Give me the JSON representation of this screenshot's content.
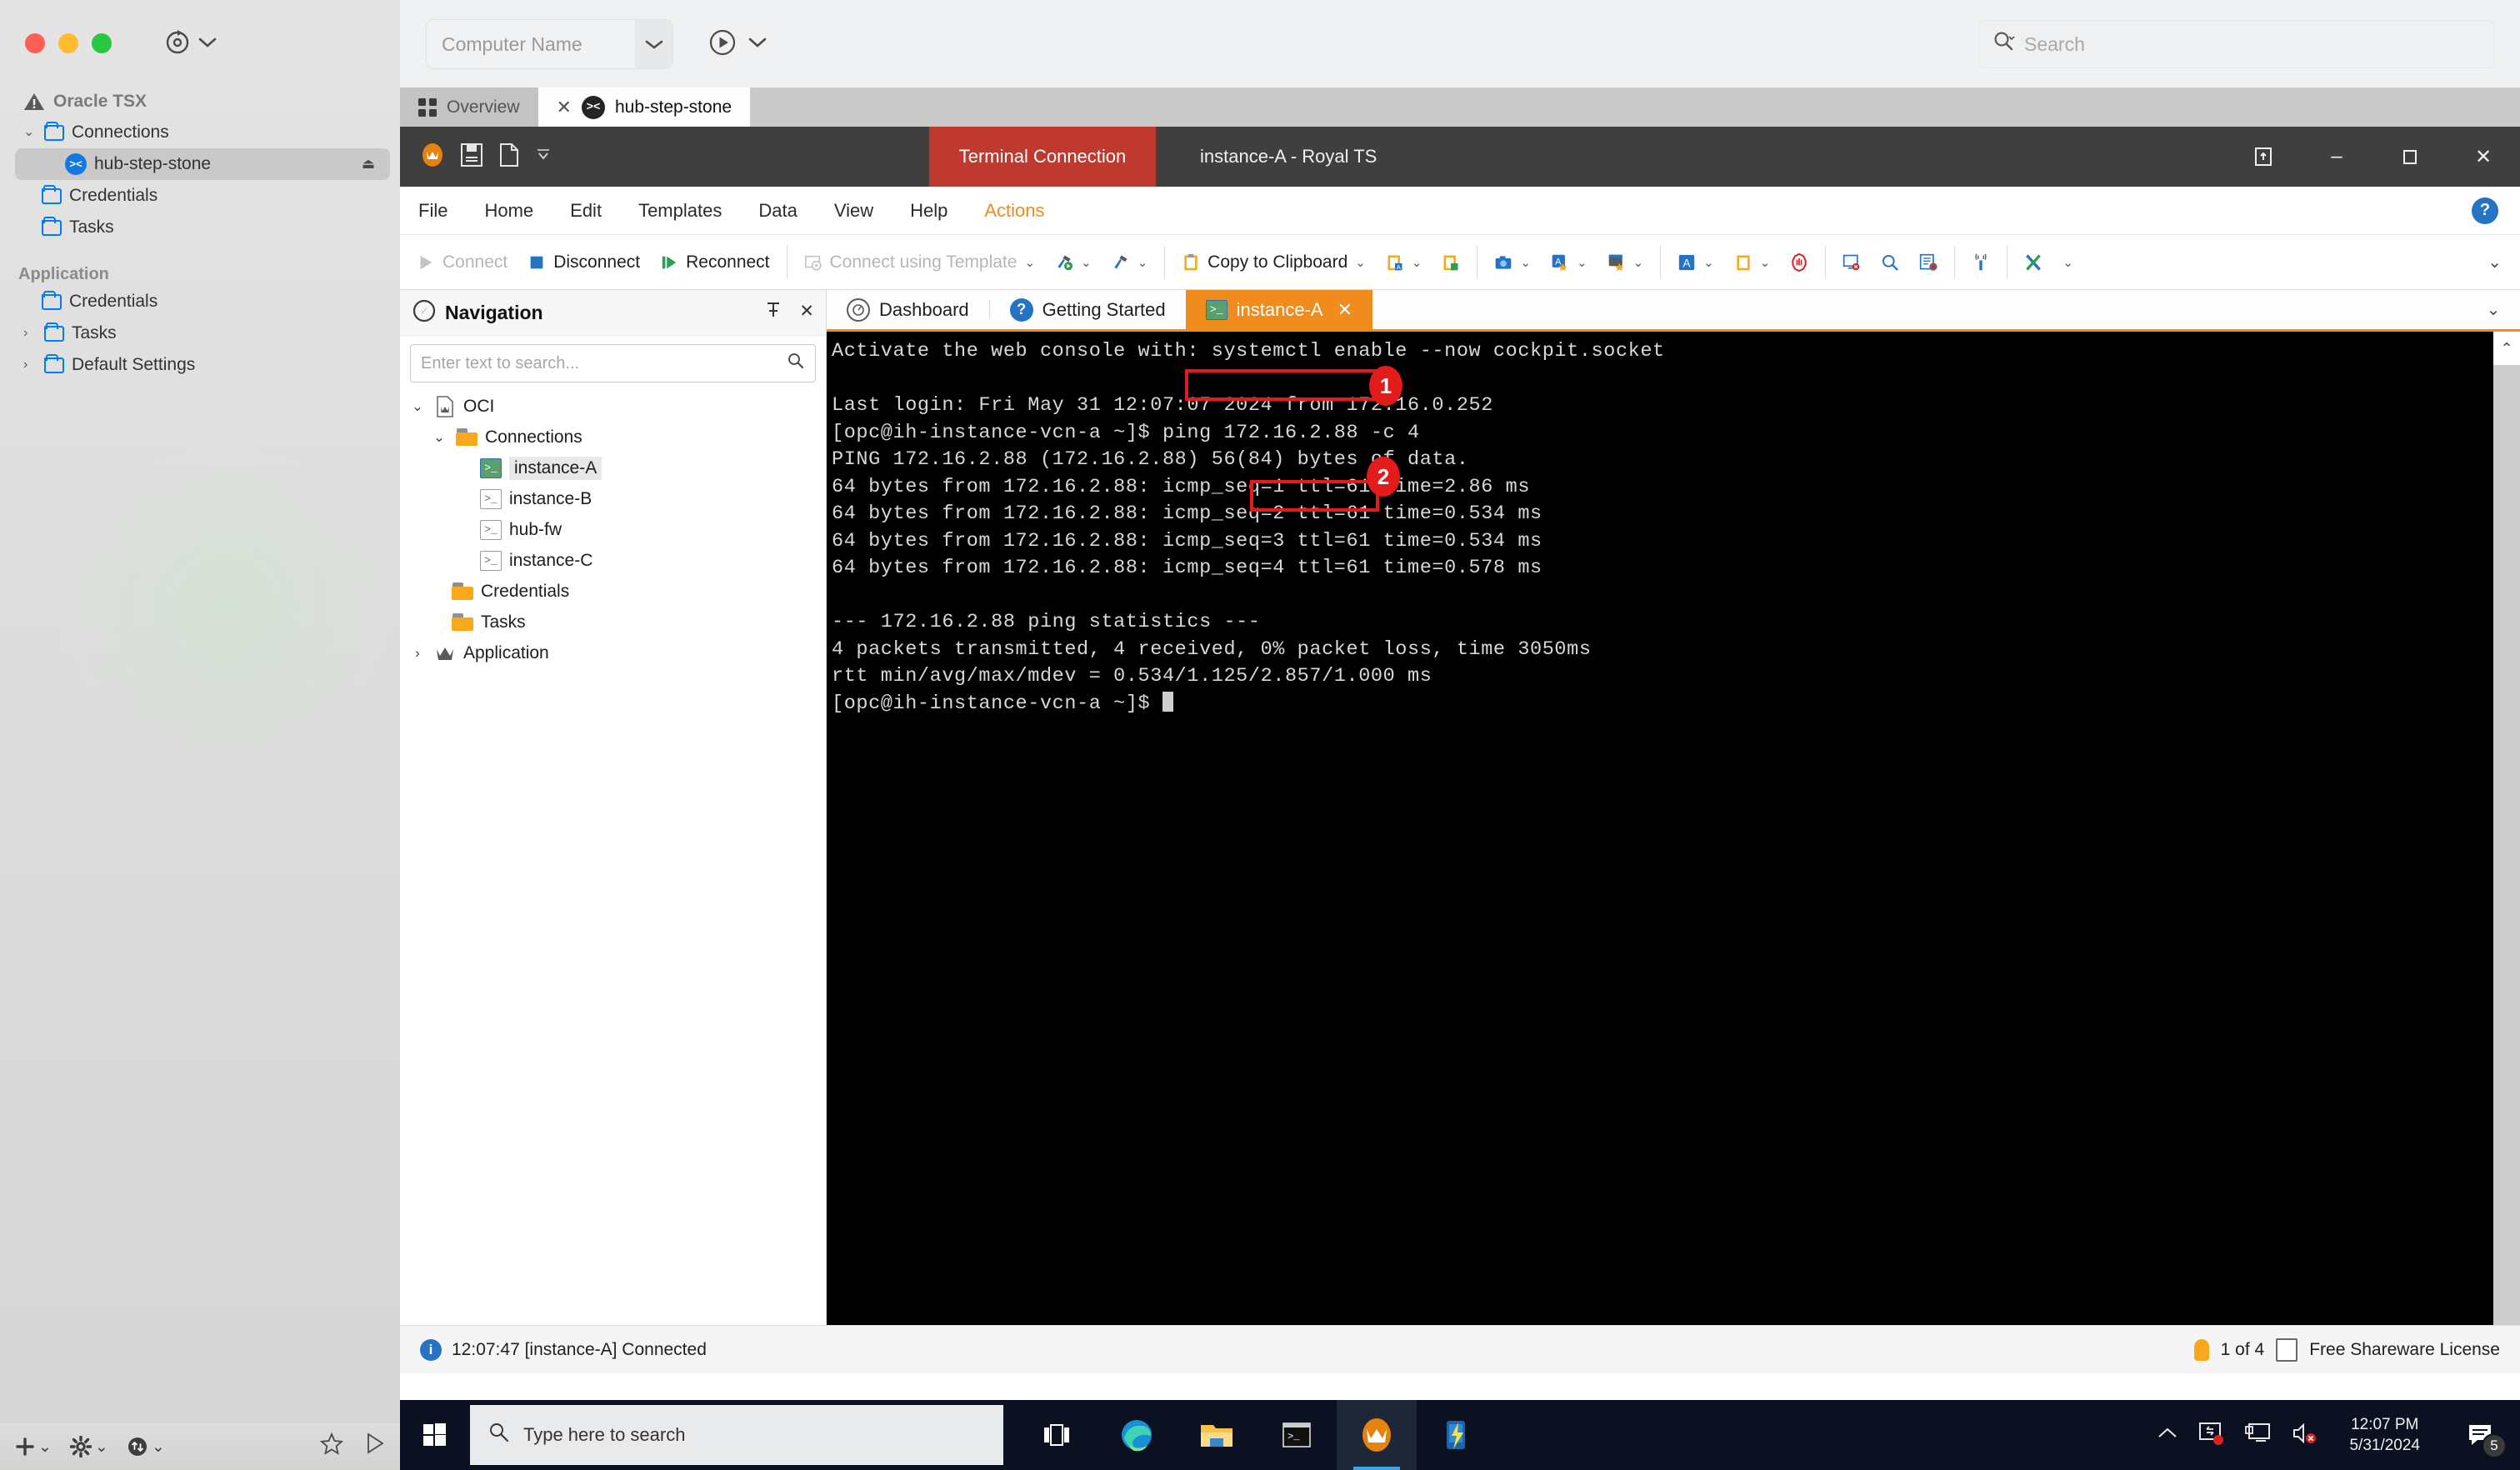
{
  "mac_host": {
    "toolbar": {
      "refresh_icon": "refresh-target-icon",
      "dropdown_icon": "chevron-down-icon"
    },
    "tree": {
      "header": {
        "label": "Oracle TSX",
        "icon": "warning-triangle-icon"
      },
      "items": [
        {
          "label": "Connections",
          "icon": "folder-icon",
          "expander": "chevron-down-icon",
          "level": 0,
          "selected": false
        },
        {
          "label": "hub-step-stone",
          "icon": "ssh-icon",
          "level": 1,
          "selected": true,
          "trailing_icon": "eject-icon"
        },
        {
          "label": "Credentials",
          "icon": "folder-icon",
          "level": 0,
          "selected": false
        },
        {
          "label": "Tasks",
          "icon": "folder-icon",
          "level": 0,
          "selected": false
        }
      ],
      "section_label": "Application",
      "app_items": [
        {
          "label": "Credentials",
          "icon": "folder-icon",
          "expander": "",
          "level": 0
        },
        {
          "label": "Tasks",
          "icon": "folder-icon",
          "expander": "chevron-right-icon",
          "level": 0
        },
        {
          "label": "Default Settings",
          "icon": "folder-icon",
          "expander": "chevron-right-icon",
          "level": 0
        }
      ]
    },
    "bottom_bar": {
      "add_icon": "plus-icon",
      "settings_icon": "gear-icon",
      "network_icon": "network-transfer-icon",
      "favorite_icon": "star-icon",
      "play_icon": "play-triangle-icon"
    }
  },
  "vm_topbar": {
    "computer_name_placeholder": "Computer Name",
    "dropdown_icon": "chevron-down-icon",
    "play_icon": "play-circle-icon",
    "play_dropdown_icon": "chevron-down-icon",
    "search_placeholder": "Search",
    "search_icon": "search-icon"
  },
  "vm_tabs": [
    {
      "label": "Overview",
      "icon": "grid-icon",
      "active": false,
      "closable": false
    },
    {
      "label": "hub-step-stone",
      "icon": "ssh-icon",
      "active": true,
      "closable": true,
      "close_icon": "close-icon"
    }
  ],
  "royal_ts": {
    "title": "instance-A - Royal TS",
    "context_tag": "Terminal Connection",
    "quick_access": [
      {
        "name": "royal-ts-logo-icon"
      },
      {
        "name": "save-icon"
      },
      {
        "name": "new-document-icon"
      },
      {
        "name": "customize-qat-chevron-icon"
      }
    ],
    "window_buttons": [
      {
        "name": "ribbon-display-options-icon",
        "glyph": "⬚"
      },
      {
        "name": "minimize-icon",
        "glyph": "–"
      },
      {
        "name": "restore-icon",
        "glyph": "❐"
      },
      {
        "name": "close-icon",
        "glyph": "✕"
      }
    ],
    "menu": [
      {
        "label": "File",
        "active": false
      },
      {
        "label": "Home",
        "active": false
      },
      {
        "label": "Edit",
        "active": false
      },
      {
        "label": "Templates",
        "active": false
      },
      {
        "label": "Data",
        "active": false
      },
      {
        "label": "View",
        "active": false
      },
      {
        "label": "Help",
        "active": false
      },
      {
        "label": "Actions",
        "active": true
      }
    ],
    "help_button": "?",
    "ribbon": {
      "connect_label": "Connect",
      "disconnect_label": "Disconnect",
      "reconnect_label": "Reconnect",
      "connect_template_label": "Connect using Template",
      "copy_clipboard_label": "Copy to Clipboard",
      "expand_icon": "chevron-down-icon"
    },
    "navigation": {
      "title": "Navigation",
      "panel_icon": "compass-icon",
      "pin_icon": "pin-icon",
      "close_icon": "close-icon",
      "search_placeholder": "Enter text to search...",
      "search_icon": "search-icon",
      "tree": [
        {
          "label": "OCI",
          "level": 0,
          "icon": "document-crown-icon",
          "expander": "chevron-down-icon",
          "selected": false
        },
        {
          "label": "Connections",
          "level": 1,
          "icon": "folder-icon",
          "expander": "chevron-down-icon",
          "selected": false
        },
        {
          "label": "instance-A",
          "level": 2,
          "icon": "terminal-icon-active",
          "expander": "",
          "selected": true
        },
        {
          "label": "instance-B",
          "level": 2,
          "icon": "terminal-icon",
          "expander": "",
          "selected": false
        },
        {
          "label": "hub-fw",
          "level": 2,
          "icon": "terminal-icon",
          "expander": "",
          "selected": false
        },
        {
          "label": "instance-C",
          "level": 2,
          "icon": "terminal-icon",
          "expander": "",
          "selected": false
        },
        {
          "label": "Credentials",
          "level": 1,
          "icon": "folder-icon",
          "expander": "",
          "selected": false
        },
        {
          "label": "Tasks",
          "level": 1,
          "icon": "folder-icon",
          "expander": "",
          "selected": false
        },
        {
          "label": "Application",
          "level": 0,
          "icon": "crown-icon",
          "expander": "chevron-right-icon",
          "selected": false
        }
      ]
    },
    "doc_tabs": [
      {
        "label": "Dashboard",
        "icon": "dashboard-icon",
        "active": false,
        "closable": false
      },
      {
        "label": "Getting Started",
        "icon": "help-icon",
        "active": false,
        "closable": false
      },
      {
        "label": "instance-A",
        "icon": "terminal-icon-active",
        "active": true,
        "closable": true,
        "close_icon": "close-icon"
      }
    ],
    "terminal": {
      "lines": [
        "Activate the web console with: systemctl enable --now cockpit.socket",
        "",
        "Last login: Fri May 31 12:07:07 2024 from 172.16.0.252",
        "[opc@ih-instance-vcn-a ~]$ ping 172.16.2.88 -c 4",
        "PING 172.16.2.88 (172.16.2.88) 56(84) bytes of data.",
        "64 bytes from 172.16.2.88: icmp_seq=1 ttl=61 time=2.86 ms",
        "64 bytes from 172.16.2.88: icmp_seq=2 ttl=61 time=0.534 ms",
        "64 bytes from 172.16.2.88: icmp_seq=3 ttl=61 time=0.534 ms",
        "64 bytes from 172.16.2.88: icmp_seq=4 ttl=61 time=0.578 ms",
        "",
        "--- 172.16.2.88 ping statistics ---",
        "4 packets transmitted, 4 received, 0% packet loss, time 3050ms",
        "rtt min/avg/max/mdev = 0.534/1.125/2.857/1.000 ms",
        "[opc@ih-instance-vcn-a ~]$ "
      ],
      "scroll_up_icon": "chevron-up-icon"
    },
    "annotations": [
      {
        "number": "1",
        "target_text": "ping 172.16.2.88 -c 4"
      },
      {
        "number": "2",
        "target_text": "0% packet loss,"
      }
    ],
    "status_bar": {
      "info_icon": "info-icon",
      "message": "12:07:47 [instance-A] Connected",
      "tip_icon": "lightbulb-icon",
      "tip_counter": "1 of 4",
      "license_icon": "certificate-icon",
      "license": "Free Shareware License"
    }
  },
  "taskbar": {
    "start_icon": "windows-start-icon",
    "search_placeholder": "Type here to search",
    "search_icon": "search-icon",
    "items": [
      {
        "name": "task-view-icon"
      },
      {
        "name": "edge-browser-icon"
      },
      {
        "name": "file-explorer-icon"
      },
      {
        "name": "terminal-icon"
      },
      {
        "name": "royal-ts-icon",
        "active": true
      },
      {
        "name": "remote-app-icon"
      }
    ],
    "tray": [
      {
        "name": "show-hidden-icons-chevron-icon"
      },
      {
        "name": "screen-recording-icon"
      },
      {
        "name": "network-monitor-icon"
      },
      {
        "name": "volume-muted-icon"
      }
    ],
    "clock_time": "12:07 PM",
    "clock_date": "5/31/2024",
    "notification_icon": "notifications-icon",
    "notification_count": "5"
  },
  "colors": {
    "accent_orange": "#f08b1d",
    "terminal_red": "#c0392f",
    "annotation_red": "#e31b1b",
    "blue": "#2573c4",
    "folder_orange": "#f7a81b"
  }
}
